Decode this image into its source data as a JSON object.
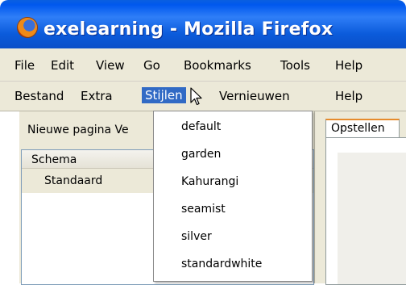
{
  "window": {
    "title": "exelearning - Mozilla Firefox"
  },
  "browser_menu": [
    {
      "label": "File"
    },
    {
      "label": "Edit"
    },
    {
      "label": "View"
    },
    {
      "label": "Go"
    },
    {
      "label": "Bookmarks"
    },
    {
      "label": "Tools"
    },
    {
      "label": "Help"
    }
  ],
  "app_menu": [
    {
      "label": "Bestand"
    },
    {
      "label": "Extra"
    },
    {
      "label": "Stijlen"
    },
    {
      "label": "Vernieuwen"
    },
    {
      "label": "Help"
    }
  ],
  "toolbar": {
    "text": "Nieuwe pagina  Ve"
  },
  "outline": {
    "header": "Schema",
    "rows": [
      "Standaard"
    ]
  },
  "tabs": [
    {
      "label": "Opstellen"
    }
  ],
  "styles_menu": {
    "items": [
      "default",
      "garden",
      "Kahurangi",
      "seamist",
      "silver",
      "standardwhite"
    ]
  },
  "colors": {
    "titlebar": "#0058ee",
    "selected_menu": "#316ac5",
    "chrome": "#ece9d8"
  },
  "icons": {
    "app": "firefox-logo-icon",
    "cursor": "mouse-pointer-icon"
  }
}
